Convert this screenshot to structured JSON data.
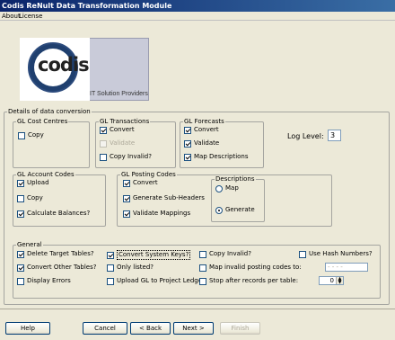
{
  "window": {
    "title": "Codis ReNult Data Transformation Module"
  },
  "menu": {
    "items": [
      "About",
      "License"
    ]
  },
  "logo": {
    "text": "codis",
    "tagline": "IT Solution Providers"
  },
  "details_legend": "Details of data conversion",
  "gl_cost_centres": {
    "legend": "GL Cost Centres",
    "copy": "Copy"
  },
  "gl_transactions": {
    "legend": "GL Transactions",
    "convert": "Convert",
    "validate": "Validate",
    "copy_invalid": "Copy Invalid?"
  },
  "gl_forecasts": {
    "legend": "GL Forecasts",
    "convert": "Convert",
    "validate": "Validate",
    "map_descriptions": "Map Descriptions"
  },
  "log_level": {
    "label": "Log Level:",
    "value": "3"
  },
  "gl_account_codes": {
    "legend": "GL Account Codes",
    "upload": "Upload",
    "copy": "Copy",
    "calculate_balances": "Calculate Balances?"
  },
  "gl_posting_codes": {
    "legend": "GL Posting Codes",
    "convert": "Convert",
    "generate_sub_headers": "Generate Sub-Headers",
    "validate_mappings": "Validate Mappings"
  },
  "descriptions": {
    "legend": "Descriptions",
    "map": "Map",
    "generate": "Generate"
  },
  "general": {
    "legend": "General",
    "delete_target_tables": "Delete Target Tables?",
    "convert_other_tables": "Convert Other Tables?",
    "display_errors": "Display Errors",
    "convert_system_keys": "Convert System Keys?",
    "only_listed": "Only listed?",
    "upload_gl_to_project_ledger": "Upload GL to Project Ledger",
    "copy_invalid": "Copy Invalid?",
    "map_invalid_posting_codes": "Map invalid posting codes to:",
    "map_invalid_placeholder": "- - - -",
    "stop_after_records": "Stop after records per table:",
    "stop_after_value": "0",
    "use_hash_numbers": "Use Hash Numbers?"
  },
  "buttons": {
    "help": "Help",
    "cancel": "Cancel",
    "back": "< Back",
    "next": "Next >",
    "finish": "Finish"
  }
}
